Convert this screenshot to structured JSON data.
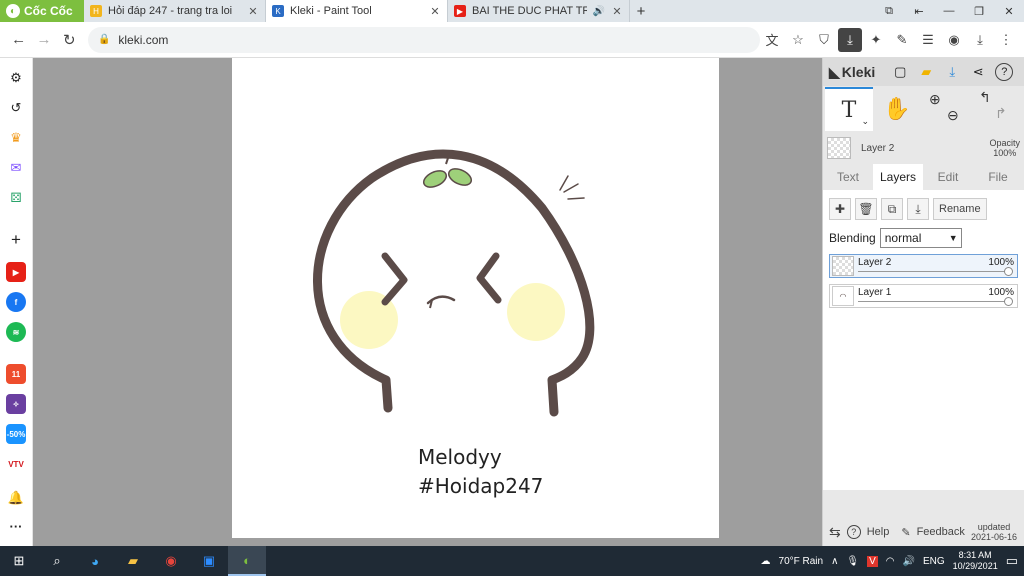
{
  "browser": {
    "brand": "Cốc Cốc",
    "tabs": [
      {
        "title": "Hỏi đáp 247 - trang tra loi",
        "active": false
      },
      {
        "title": "Kleki - Paint Tool",
        "active": true
      },
      {
        "title": "BAI THE DUC PHAT TRIEN",
        "active": false
      }
    ],
    "url": "kleki.com"
  },
  "kleki": {
    "logo": "Kleki",
    "layer_name": "Layer 2",
    "opacity_label": "Opacity",
    "opacity_value": "100%",
    "tabs": [
      "Text",
      "Layers",
      "Edit",
      "File"
    ],
    "rename_label": "Rename",
    "blending_label": "Blending",
    "blending_value": "normal",
    "layers": [
      {
        "name": "Layer 2",
        "opacity": "100%",
        "active": true
      },
      {
        "name": "Layer 1",
        "opacity": "100%",
        "active": false
      }
    ],
    "footer": {
      "help": "Help",
      "feedback": "Feedback",
      "updated_label": "updated",
      "updated_date": "2021-06-16"
    }
  },
  "canvas": {
    "line1": "Melodyy",
    "line2": "#Hoidap247"
  },
  "taskbar": {
    "weather": "70°F  Rain",
    "lang": "ENG",
    "time": "8:31 AM",
    "date": "10/29/2021"
  },
  "colors": {
    "tab_brand": "#7dbf3f",
    "stroke": "#5b4b48",
    "blush": "#fcf8c2",
    "sprout": "#9ed07a",
    "accent": "#2b88d8"
  }
}
